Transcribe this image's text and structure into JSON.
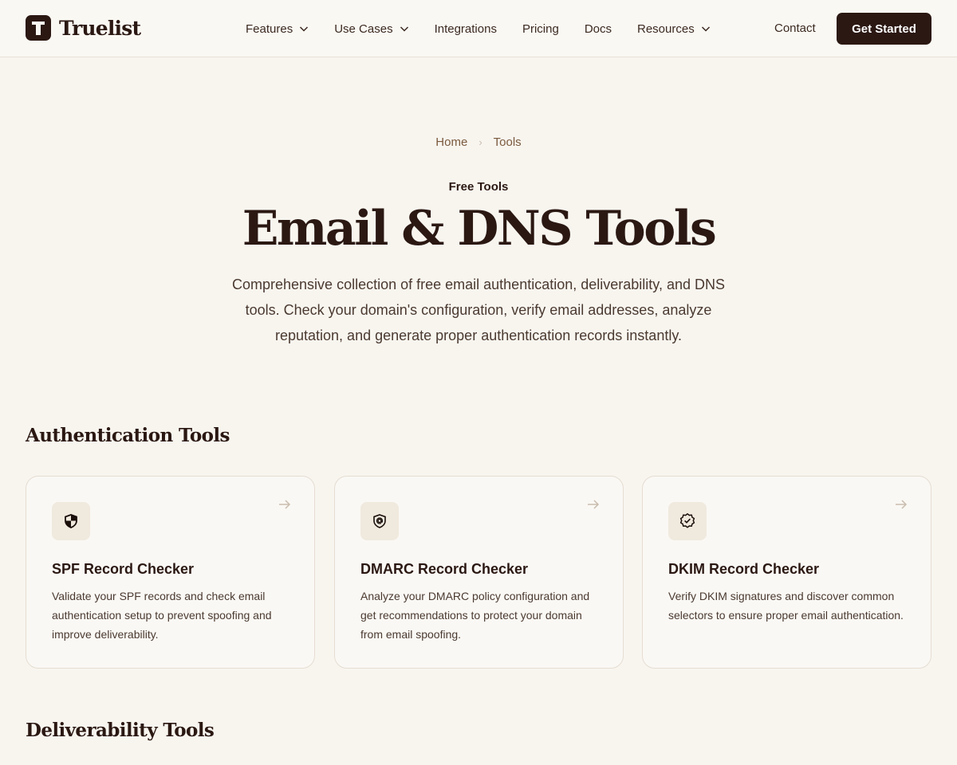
{
  "header": {
    "brand": "Truelist",
    "nav": [
      {
        "label": "Features",
        "dropdown": true
      },
      {
        "label": "Use Cases",
        "dropdown": true
      },
      {
        "label": "Integrations",
        "dropdown": false
      },
      {
        "label": "Pricing",
        "dropdown": false
      },
      {
        "label": "Docs",
        "dropdown": false
      },
      {
        "label": "Resources",
        "dropdown": true
      }
    ],
    "contact": "Contact",
    "cta": "Get Started"
  },
  "breadcrumb": {
    "home": "Home",
    "current": "Tools"
  },
  "hero": {
    "eyebrow": "Free Tools",
    "title": "Email & DNS Tools",
    "description": "Comprehensive collection of free email authentication, deliverability, and DNS tools. Check your domain's configuration, verify email addresses, analyze reputation, and generate proper authentication records instantly."
  },
  "sections": [
    {
      "title": "Authentication Tools",
      "cards": [
        {
          "icon": "shield-icon",
          "title": "SPF Record Checker",
          "description": "Validate your SPF records and check email authentication setup to prevent spoofing and improve deliverability."
        },
        {
          "icon": "shield-at-icon",
          "title": "DMARC Record Checker",
          "description": "Analyze your DMARC policy configuration and get recommendations to protect your domain from email spoofing."
        },
        {
          "icon": "badge-check-icon",
          "title": "DKIM Record Checker",
          "description": "Verify DKIM signatures and discover common selectors to ensure proper email authentication."
        }
      ]
    },
    {
      "title": "Deliverability Tools"
    }
  ],
  "colors": {
    "brand": "#2b1813",
    "background": "#f8f5ef",
    "accent_text": "#7a5a3e"
  }
}
